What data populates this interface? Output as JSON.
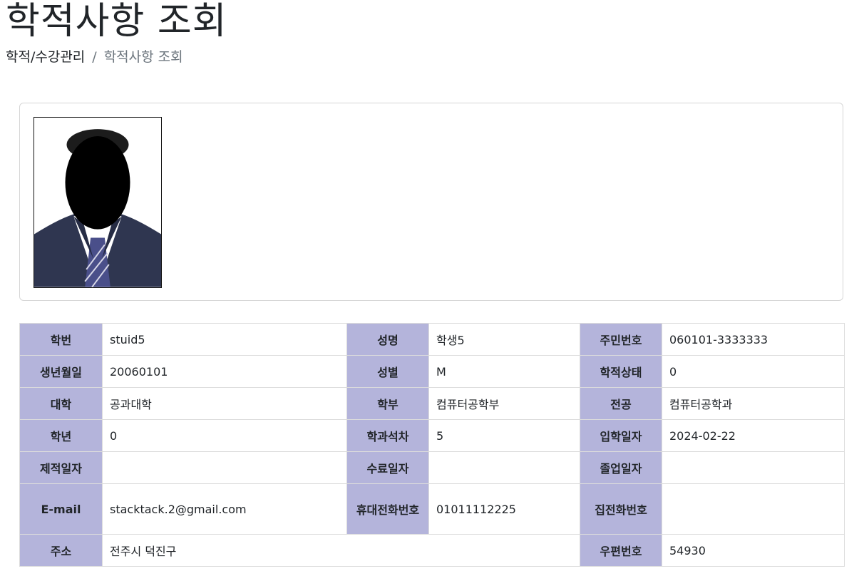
{
  "header": {
    "title": "학적사항 조회",
    "breadcrumb": [
      {
        "label": "학적/수강관리"
      },
      {
        "label": "학적사항 조회"
      }
    ],
    "breadcrumb_separator": "/"
  },
  "photo": {
    "icon": "student-photo-silhouette"
  },
  "colors": {
    "label_bg": "#b4b4db",
    "border": "#dcdcdc"
  },
  "info": {
    "student_id_label": "학번",
    "student_id": "stuid5",
    "name_label": "성명",
    "name": "학생5",
    "resident_no_label": "주민번호",
    "resident_no": "060101-3333333",
    "birth_label": "생년월일",
    "birth": "20060101",
    "gender_label": "성별",
    "gender": "M",
    "status_label": "학적상태",
    "status": "0",
    "college_label": "대학",
    "college": "공과대학",
    "school_label": "학부",
    "school": "컴퓨터공학부",
    "major_label": "전공",
    "major": "컴퓨터공학과",
    "grade_label": "학년",
    "grade": "0",
    "rank_label": "학과석차",
    "rank": "5",
    "admission_label": "입학일자",
    "admission": "2024-02-22",
    "expelled_label": "제적일자",
    "expelled": "",
    "completion_label": "수료일자",
    "completion": "",
    "graduation_label": "졸업일자",
    "graduation": "",
    "email_label": "E-mail",
    "email": "stacktack.2@gmail.com",
    "mobile_label": "휴대전화번호",
    "mobile": "01011112225",
    "home_phone_label": "집전화번호",
    "home_phone": "",
    "address_label": "주소",
    "address": "전주시 덕진구",
    "postal_label": "우편번호",
    "postal": "54930"
  }
}
